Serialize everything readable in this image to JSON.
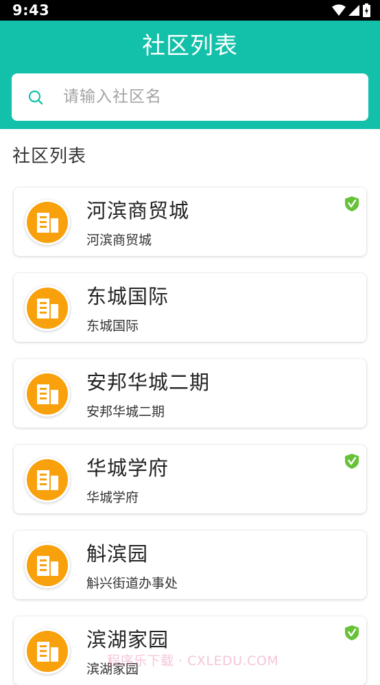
{
  "status_bar": {
    "time": "9:43"
  },
  "header": {
    "title": "社区列表"
  },
  "search": {
    "placeholder": "请输入社区名"
  },
  "section": {
    "title": "社区列表"
  },
  "communities": [
    {
      "name": "河滨商贸城",
      "subtitle": "河滨商贸城",
      "verified": true
    },
    {
      "name": "东城国际",
      "subtitle": "东城国际",
      "verified": false
    },
    {
      "name": "安邦华城二期",
      "subtitle": "安邦华城二期",
      "verified": false
    },
    {
      "name": "华城学府",
      "subtitle": "华城学府",
      "verified": true
    },
    {
      "name": "斛滨园",
      "subtitle": "斛兴街道办事处",
      "verified": false
    },
    {
      "name": "滨湖家园",
      "subtitle": "滨湖家园",
      "verified": true
    }
  ],
  "watermark": {
    "text": "程序乐下载 · CXLEDU.COM"
  },
  "icons": {
    "community": "building-icon",
    "verified": "verified-shield-icon",
    "search": "search-icon"
  },
  "colors": {
    "header_bg": "#13c0a9",
    "icon_orange": "#f8a10d",
    "verified_green": "#67c23a",
    "search_icon": "#13c0a9"
  }
}
